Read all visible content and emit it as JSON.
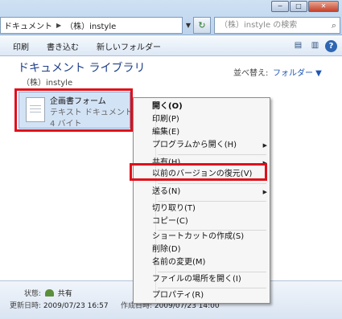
{
  "address": {
    "crumbs": [
      "ドキュメント",
      "（株）instyle"
    ]
  },
  "search": {
    "placeholder": "（株）instyle の検索"
  },
  "toolbar": {
    "items": [
      "印刷",
      "書き込む",
      "新しいフォルダー"
    ]
  },
  "library": {
    "title": "ドキュメント ライブラリ",
    "subtitle": "（株）instyle",
    "sort_label": "並べ替え:",
    "sort_value": "フォルダー ▼"
  },
  "file": {
    "name": "企画書フォーム",
    "type": "テキスト ドキュメント",
    "size": "4 バイト"
  },
  "status": {
    "state_label": "状態:",
    "state_value": "共有",
    "modified_label": "更新日時:",
    "modified_value": "2009/07/23 16:57",
    "created_label": "作成日時:",
    "created_value": "2009/07/23 14:00"
  },
  "context_menu": {
    "items": [
      {
        "label": "開く(O)",
        "bold": true
      },
      {
        "label": "印刷(P)"
      },
      {
        "label": "編集(E)"
      },
      {
        "label": "プログラムから開く(H)",
        "submenu": true
      },
      {
        "label": "共有(H)",
        "submenu": true
      },
      {
        "label": "以前のバージョンの復元(V)",
        "highlighted": true
      },
      {
        "label": "送る(N)",
        "submenu": true
      },
      {
        "label": "切り取り(T)"
      },
      {
        "label": "コピー(C)"
      },
      {
        "label": "ショートカットの作成(S)"
      },
      {
        "label": "削除(D)"
      },
      {
        "label": "名前の変更(M)"
      },
      {
        "label": "ファイルの場所を開く(I)"
      },
      {
        "label": "プロパティ(R)"
      }
    ]
  },
  "colors": {
    "highlight_red": "#e00f1a",
    "library_title": "#1e3f8a",
    "link_blue": "#1f56b2"
  }
}
